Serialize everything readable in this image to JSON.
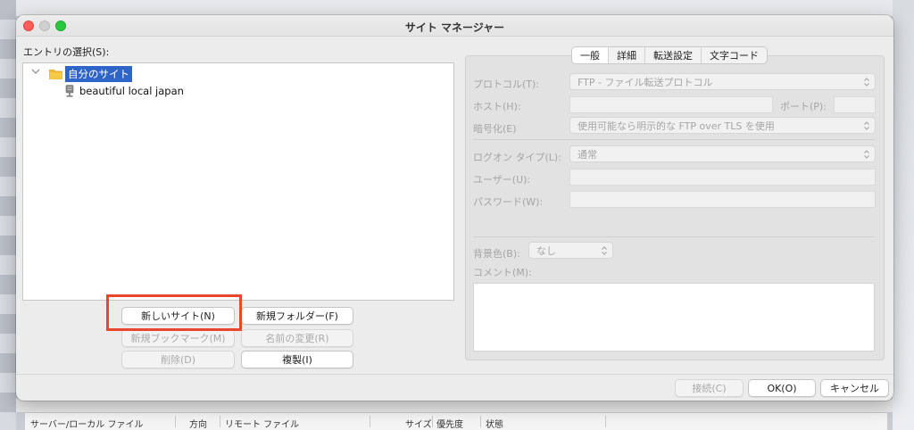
{
  "dialog": {
    "title": "サイト マネージャー"
  },
  "entry": {
    "label": "エントリの選択(S):",
    "tree": {
      "folder": "自分のサイト",
      "sites": [
        "beautiful local japan"
      ]
    }
  },
  "left_buttons": {
    "new_site": "新しいサイト(N)",
    "new_folder": "新規フォルダー(F)",
    "new_bookmark": "新規ブックマーク(M)",
    "rename": "名前の変更(R)",
    "delete": "削除(D)",
    "duplicate": "複製(I)"
  },
  "tabs": [
    {
      "label": "一般",
      "active": true
    },
    {
      "label": "詳細",
      "active": false
    },
    {
      "label": "転送設定",
      "active": false
    },
    {
      "label": "文字コード",
      "active": false
    }
  ],
  "general": {
    "protocol_label": "プロトコル(T):",
    "protocol_value": "FTP - ファイル転送プロトコル",
    "host_label": "ホスト(H):",
    "host_value": "",
    "port_label": "ポート(P):",
    "port_value": "",
    "encryption_label": "暗号化(E)",
    "encryption_value": "使用可能なら明示的な FTP over TLS を使用",
    "logon_label": "ログオン タイプ(L):",
    "logon_value": "通常",
    "user_label": "ユーザー(U):",
    "user_value": "",
    "password_label": "パスワード(W):",
    "password_value": "",
    "bgcolor_label": "背景色(B):",
    "bgcolor_value": "なし",
    "comment_label": "コメント(M):",
    "comment_value": ""
  },
  "footer_buttons": {
    "connect": "接続(C)",
    "ok": "OK(O)",
    "cancel": "キャンセル"
  },
  "statusbar": {
    "col1": "サーバー/ローカル ファイル",
    "col2": "方向",
    "col3": "リモート ファイル",
    "col4": "サイズ",
    "col5": "優先度",
    "col6": "状態"
  },
  "colors": {
    "highlight_box": "#e8472e",
    "selection": "#2f64c9",
    "close": "#ff5f57",
    "maximize": "#28c840"
  }
}
